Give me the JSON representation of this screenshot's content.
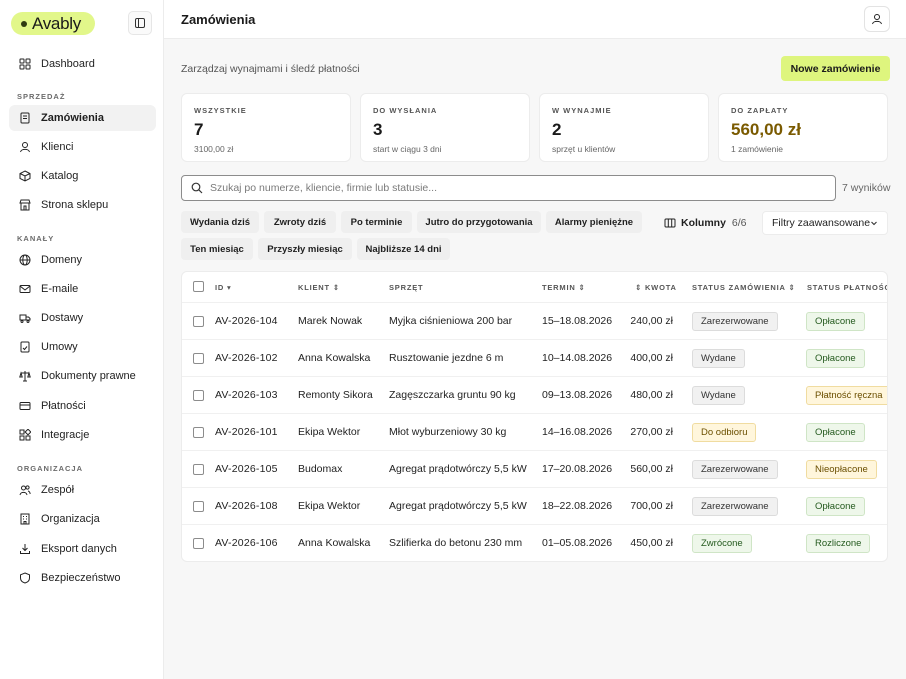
{
  "app": {
    "logo": "Avably"
  },
  "sidebar": {
    "dashboard": "Dashboard",
    "section_sales": "SPRZEDAŻ",
    "sales": [
      "Zamówienia",
      "Klienci",
      "Katalog",
      "Strona sklepu"
    ],
    "section_channels": "KANAŁY",
    "channels": [
      "Domeny",
      "E-maile",
      "Dostawy",
      "Umowy",
      "Dokumenty prawne",
      "Płatności",
      "Integracje"
    ],
    "section_org": "ORGANIZACJA",
    "org": [
      "Zespół",
      "Organizacja",
      "Eksport danych",
      "Bezpieczeństwo"
    ]
  },
  "header": {
    "title": "Zamówienia"
  },
  "main": {
    "subtitle": "Zarządzaj wynajmami i śledź płatności",
    "new_order": "Nowe zamówienie",
    "cards": [
      {
        "label": "WSZYSTKIE",
        "value": "7",
        "sub": "3100,00 zł"
      },
      {
        "label": "DO WYSŁANIA",
        "value": "3",
        "sub": "start w ciągu 3 dni"
      },
      {
        "label": "W WYNAJMIE",
        "value": "2",
        "sub": "sprzęt u klientów"
      },
      {
        "label": "DO ZAPŁATY",
        "value": "560,00 zł",
        "sub": "1 zamówienie"
      }
    ],
    "search_placeholder": "Szukaj po numerze, kliencie, firmie lub statusie...",
    "results": "7 wyników",
    "chips": [
      "Wydania dziś",
      "Zwroty dziś",
      "Po terminie",
      "Jutro do przygotowania",
      "Alarmy pieniężne",
      "Ten miesiąc",
      "Przyszły miesiąc",
      "Najbliższe 14 dni"
    ],
    "columns_label": "Kolumny",
    "columns_count": "6/6",
    "filters_label": "Filtry zaawansowane"
  },
  "table": {
    "headers": {
      "id": "ID ▾",
      "client": "KLIENT ⇕",
      "equipment": "SPRZĘT",
      "term": "TERMIN ⇕",
      "amount": "⇕ KWOTA",
      "order_status": "STATUS ZAMÓWIENIA ⇕",
      "payment_status": "STATUS PŁATNOŚCI"
    },
    "rows": [
      {
        "id": "AV-2026-104",
        "client": "Marek Nowak",
        "equipment": "Myjka ciśnieniowa 200 bar",
        "term": "15–18.08.2026",
        "amount": "240,00 zł",
        "order_status": "Zarezerwowane",
        "payment_status": "Opłacone"
      },
      {
        "id": "AV-2026-102",
        "client": "Anna Kowalska",
        "equipment": "Rusztowanie jezdne 6 m",
        "term": "10–14.08.2026",
        "amount": "400,00 zł",
        "order_status": "Wydane",
        "payment_status": "Opłacone"
      },
      {
        "id": "AV-2026-103",
        "client": "Remonty Sikora",
        "equipment": "Zagęszczarka gruntu 90 kg",
        "term": "09–13.08.2026",
        "amount": "480,00 zł",
        "order_status": "Wydane",
        "payment_status": "Płatność ręczna"
      },
      {
        "id": "AV-2026-101",
        "client": "Ekipa Wektor",
        "equipment": "Młot wyburzeniowy 30 kg",
        "term": "14–16.08.2026",
        "amount": "270,00 zł",
        "order_status": "Do odbioru",
        "payment_status": "Opłacone"
      },
      {
        "id": "AV-2026-105",
        "client": "Budomax",
        "equipment": "Agregat prądotwórczy 5,5 kW",
        "term": "17–20.08.2026",
        "amount": "560,00 zł",
        "order_status": "Zarezerwowane",
        "payment_status": "Nieopłacone"
      },
      {
        "id": "AV-2026-108",
        "client": "Ekipa Wektor",
        "equipment": "Agregat prądotwórczy 5,5 kW",
        "term": "18–22.08.2026",
        "amount": "700,00 zł",
        "order_status": "Zarezerwowane",
        "payment_status": "Opłacone"
      },
      {
        "id": "AV-2026-106",
        "client": "Anna Kowalska",
        "equipment": "Szlifierka do betonu 230 mm",
        "term": "01–05.08.2026",
        "amount": "450,00 zł",
        "order_status": "Zwrócone",
        "payment_status": "Rozliczone"
      }
    ]
  },
  "colors": {
    "accent": "#def57e",
    "money": "#7a5a00"
  }
}
